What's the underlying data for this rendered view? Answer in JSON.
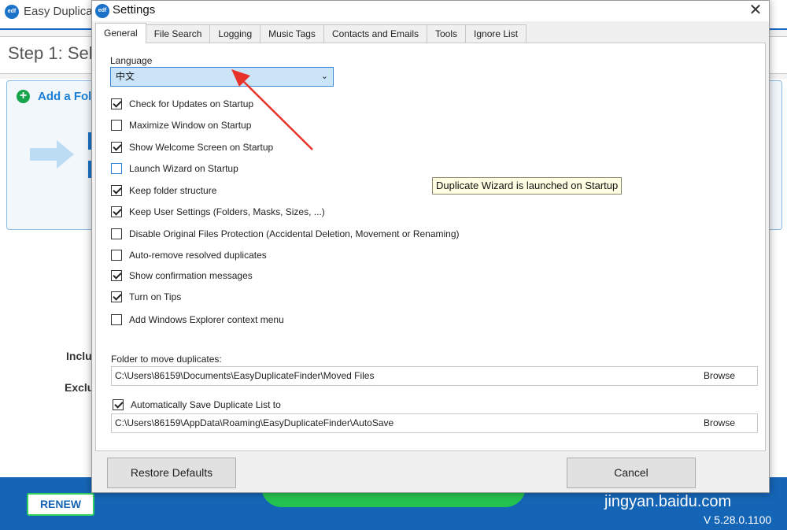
{
  "background": {
    "logo_text": "edf",
    "title": "Easy Duplicat",
    "step_title": "Step 1: Sele",
    "add_folder": "Add a Fol",
    "include_label": "Inclu",
    "exclude_label": "Exclu",
    "renew_label": "RENEW",
    "watermark": "jingyan.baidu.com",
    "version": "V 5.28.0.1100"
  },
  "dialog": {
    "icon_text": "edf",
    "title": "Settings",
    "close_glyph": "✕",
    "tabs": [
      {
        "label": "General",
        "active": true
      },
      {
        "label": "File Search"
      },
      {
        "label": "Logging"
      },
      {
        "label": "Music Tags"
      },
      {
        "label": "Contacts and Emails"
      },
      {
        "label": "Tools"
      },
      {
        "label": "Ignore List"
      }
    ],
    "language_label": "Language",
    "language_value": "中文",
    "options": [
      {
        "label": "Check for Updates on Startup",
        "checked": true
      },
      {
        "label": "Maximize Window on Startup",
        "checked": false
      },
      {
        "label": "Show Welcome Screen on Startup",
        "checked": true
      },
      {
        "label": "Launch Wizard on Startup",
        "checked": false
      },
      {
        "label": "Keep folder structure",
        "checked": true
      },
      {
        "label": "Keep User Settings (Folders, Masks, Sizes, ...)",
        "checked": true
      },
      {
        "label": "Disable Original Files Protection (Accidental Deletion, Movement or Renaming)",
        "checked": false
      },
      {
        "label": "Auto-remove resolved duplicates",
        "checked": false
      },
      {
        "label": "Show confirmation messages",
        "checked": true
      },
      {
        "label": "Turn on Tips",
        "checked": true
      },
      {
        "label": "Add Windows Explorer context menu",
        "checked": false
      }
    ],
    "tooltip": "Duplicate Wizard is launched on Startup",
    "move_folder_label": "Folder to move duplicates:",
    "move_folder_path": "C:\\Users\\86159\\Documents\\EasyDuplicateFinder\\Moved Files",
    "browse_label": "Browse",
    "autosave_label": "Automatically Save Duplicate List to",
    "autosave_checked": true,
    "autosave_path": "C:\\Users\\86159\\AppData\\Roaming\\EasyDuplicateFinder\\AutoSave",
    "restore_defaults": "Restore Defaults",
    "cancel": "Cancel"
  },
  "colors": {
    "accent_blue": "#1565b6",
    "green": "#24c24f",
    "annotation_arrow": "#e8332a",
    "selection_bg": "#cce4f7"
  }
}
